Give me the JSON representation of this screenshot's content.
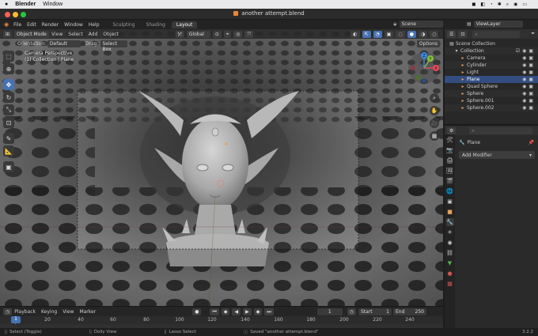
{
  "mac": {
    "app": "Blender",
    "menu": [
      "Window"
    ]
  },
  "window": {
    "title": "another attempt.blend"
  },
  "topbar": {
    "menus": [
      "File",
      "Edit",
      "Render",
      "Window",
      "Help"
    ],
    "workspaces": [
      "Sculpting",
      "Shading",
      "Layout"
    ],
    "active_workspace": "Layout",
    "scene": "Scene",
    "view_layer": "ViewLayer"
  },
  "viewport": {
    "mode": "Object Mode",
    "menus": [
      "View",
      "Select",
      "Add",
      "Object"
    ],
    "transform_orientation": "Global",
    "orientation_label": "Orientation:",
    "orientation_value": "Default",
    "drag_label": "Drag:",
    "drag_value": "Select Box",
    "options": "Options",
    "info_line1": "Camera Perspective",
    "info_line2": "(1) Collection | Plane",
    "gizmo_axes": {
      "x": "X",
      "y": "Y",
      "z": "Z"
    }
  },
  "timeline": {
    "menus": [
      "Playback",
      "Keying",
      "View",
      "Marker"
    ],
    "current_frame": "1",
    "start_label": "Start",
    "start_value": "1",
    "end_label": "End",
    "end_value": "250",
    "ruler_ticks": [
      "20",
      "40",
      "60",
      "80",
      "100",
      "120",
      "140",
      "160",
      "180",
      "200",
      "220",
      "240"
    ],
    "cursor_frame": "1"
  },
  "statusbar": {
    "left": "Select (Toggle)",
    "middle1": "Dolly View",
    "middle2": "Lasso Select",
    "message": "Saved \"another attempt.blend\"",
    "version": "3.2.2"
  },
  "outliner": {
    "root": "Scene Collection",
    "collection": "Collection",
    "items": [
      {
        "name": "Camera",
        "icon": "camera-icon",
        "color": "#e8a05a"
      },
      {
        "name": "Cylinder",
        "icon": "mesh-icon",
        "color": "#e8a05a"
      },
      {
        "name": "Light",
        "icon": "light-icon",
        "color": "#e8a05a"
      },
      {
        "name": "Plane",
        "icon": "mesh-icon",
        "color": "#e8a05a"
      },
      {
        "name": "Quad Sphere",
        "icon": "mesh-icon",
        "color": "#e8a05a"
      },
      {
        "name": "Sphere",
        "icon": "mesh-icon",
        "color": "#e8a05a"
      },
      {
        "name": "Sphere.001",
        "icon": "mesh-icon",
        "color": "#e8a05a"
      },
      {
        "name": "Sphere.002",
        "icon": "mesh-icon",
        "color": "#e8a05a"
      }
    ]
  },
  "properties": {
    "object_name": "Plane",
    "add_modifier": "Add Modifier"
  },
  "colors": {
    "accent": "#4772b3",
    "panel": "#2a2a2a",
    "viewport_bg": "#6c6c6c"
  }
}
